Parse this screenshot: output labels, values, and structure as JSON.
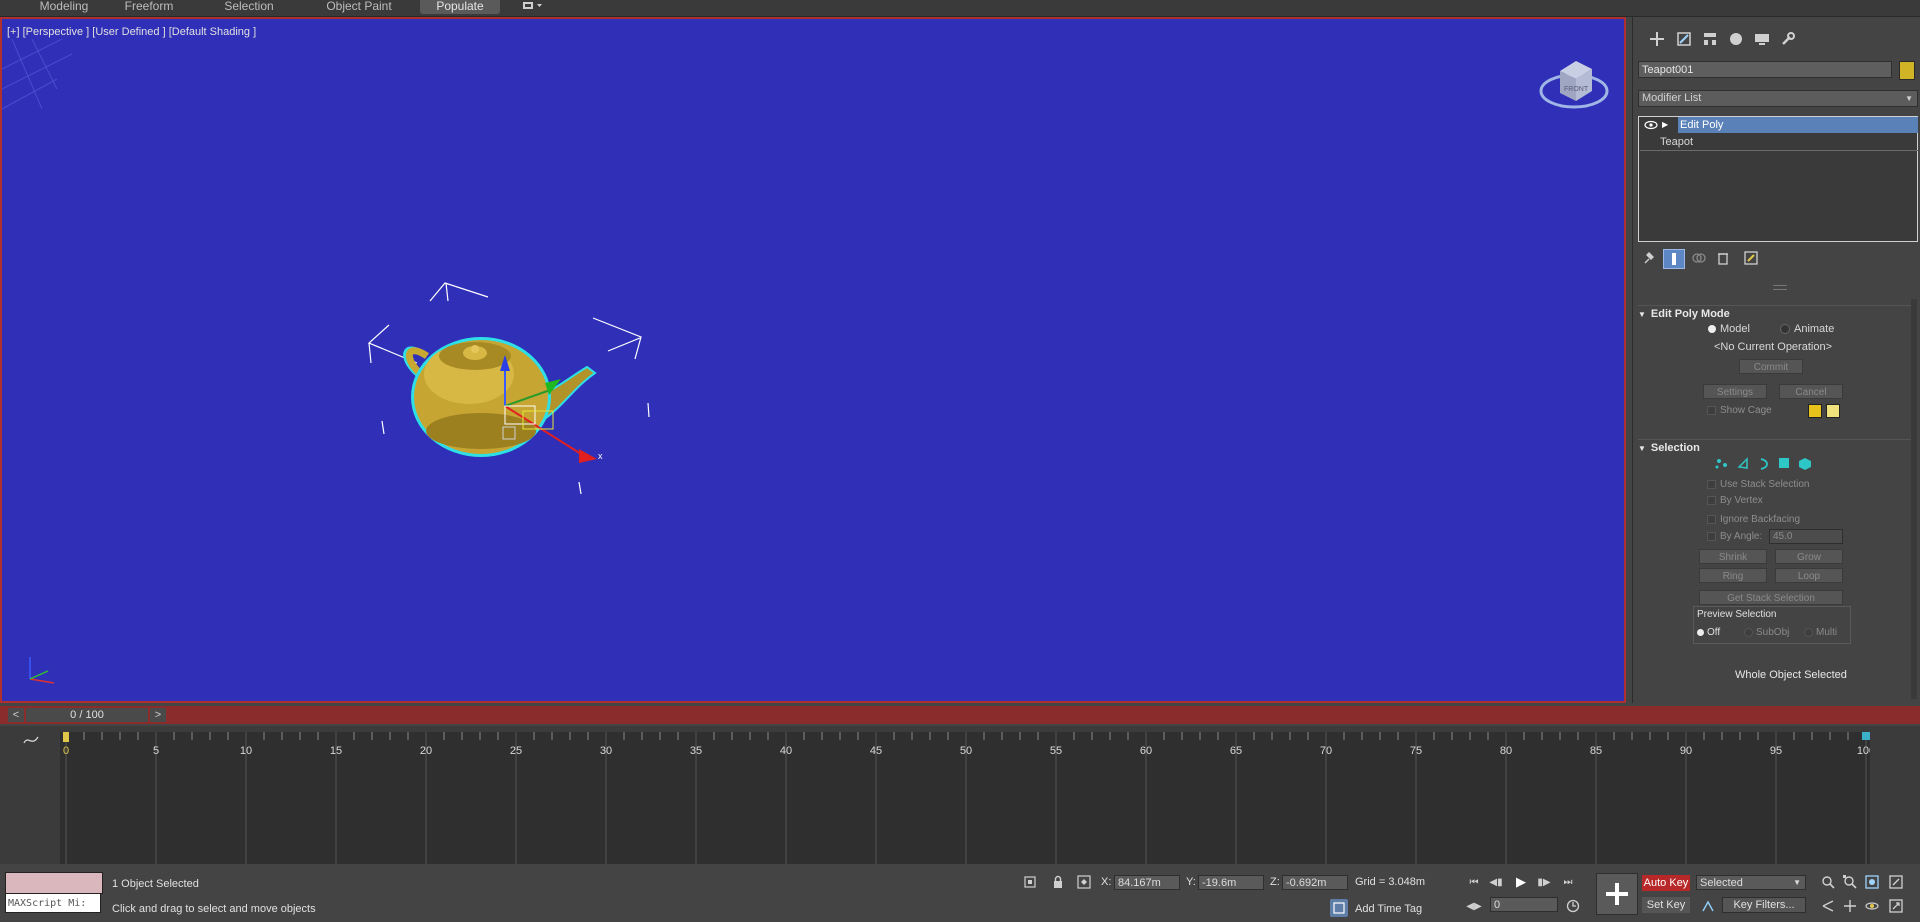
{
  "ribbon": {
    "tabs": [
      "Modeling",
      "Freeform",
      "Selection",
      "Object Paint",
      "Populate"
    ],
    "active": "Populate"
  },
  "viewport": {
    "label": "[+] [Perspective ] [User Defined ] [Default Shading ]",
    "background": "#2f2fb8",
    "gizmo_axis_x": "x",
    "viewcube_text": "FRONT"
  },
  "command_panel": {
    "tab_icons": [
      "create-icon",
      "modify-icon",
      "hierarchy-icon",
      "motion-icon",
      "display-icon",
      "utilities-icon"
    ],
    "object_name": "Teapot001",
    "object_color": "#d1b426",
    "modifier_list": "Modifier List",
    "stack": [
      {
        "label": "Edit Poly",
        "selected": true
      },
      {
        "label": "Teapot",
        "selected": false
      }
    ],
    "edit_poly_mode": {
      "title": "Edit Poly Mode",
      "model": "Model",
      "animate": "Animate",
      "status": "<No Current Operation>",
      "commit": "Commit",
      "settings": "Settings",
      "cancel": "Cancel",
      "show_cage": "Show Cage",
      "cage_color_1": "#e6c21a",
      "cage_color_2": "#efe27c"
    },
    "selection": {
      "title": "Selection",
      "use_stack": "Use Stack Selection",
      "by_vertex": "By Vertex",
      "ignore_backfacing": "Ignore Backfacing",
      "by_angle": "By Angle:",
      "angle_value": "45.0",
      "shrink": "Shrink",
      "grow": "Grow",
      "ring": "Ring",
      "loop": "Loop",
      "get_stack": "Get Stack Selection",
      "preview_title": "Preview Selection",
      "preview_off": "Off",
      "preview_subobj": "SubObj",
      "preview_multi": "Multi",
      "whole_object": "Whole Object Selected"
    }
  },
  "timeline": {
    "frame_display": "0 / 100",
    "prev": "<",
    "next": ">",
    "ticks": [
      "0",
      "5",
      "10",
      "15",
      "20",
      "25",
      "30",
      "35",
      "40",
      "45",
      "50",
      "55",
      "60",
      "65",
      "70",
      "75",
      "80",
      "85",
      "90",
      "95",
      "100"
    ]
  },
  "status": {
    "maxscript": "MAXScript Mi:",
    "selected_count": "1 Object Selected",
    "prompt": "Click and drag to select and move objects",
    "x_label": "X:",
    "x_value": "84.167m",
    "y_label": "Y:",
    "y_value": "-19.6m",
    "z_label": "Z:",
    "z_value": "-0.692m",
    "grid": "Grid = 3.048m",
    "add_time_tag": "Add Time Tag",
    "auto_key": "Auto Key",
    "set_key": "Set Key",
    "selected_dropdown": "Selected",
    "key_filters": "Key Filters...",
    "current_frame": "0"
  }
}
